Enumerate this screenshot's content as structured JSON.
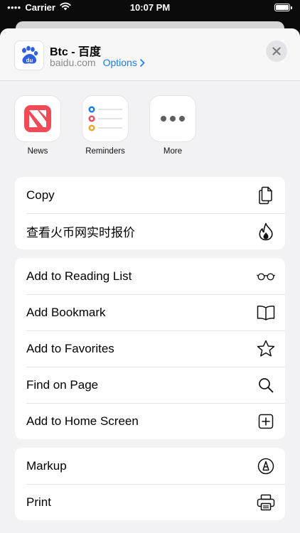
{
  "status_bar": {
    "carrier": "Carrier",
    "time": "10:07 PM"
  },
  "share_header": {
    "site_title": "Btc - 百度",
    "site_domain": "baidu.com",
    "options_label": "Options"
  },
  "apps": [
    {
      "label": "News",
      "icon": "news-icon"
    },
    {
      "label": "Reminders",
      "icon": "reminders-icon"
    },
    {
      "label": "More",
      "icon": "more-icon"
    }
  ],
  "group1": [
    {
      "label": "Copy",
      "icon": "copy-icon"
    },
    {
      "label": "查看火币网实时报价",
      "icon": "flame-icon"
    }
  ],
  "group2": [
    {
      "label": "Add to Reading List",
      "icon": "glasses-icon"
    },
    {
      "label": "Add Bookmark",
      "icon": "book-icon"
    },
    {
      "label": "Add to Favorites",
      "icon": "star-icon"
    },
    {
      "label": "Find on Page",
      "icon": "search-icon"
    },
    {
      "label": "Add to Home Screen",
      "icon": "plus-square-icon"
    }
  ],
  "group3": [
    {
      "label": "Markup",
      "icon": "markup-icon"
    },
    {
      "label": "Print",
      "icon": "printer-icon"
    }
  ],
  "colors": {
    "accent": "#1a7cf5",
    "baidu_blue": "#2f5fe0",
    "news_red": "#f14a57"
  }
}
